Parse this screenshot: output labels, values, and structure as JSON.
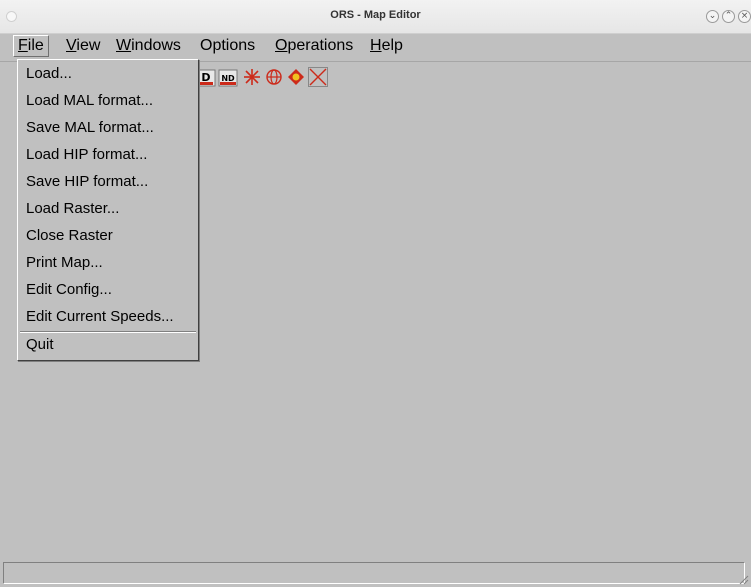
{
  "window": {
    "title": "ORS - Map Editor"
  },
  "menubar": {
    "items": [
      {
        "label": "File",
        "active": true
      },
      {
        "label": "View"
      },
      {
        "label": "Windows"
      },
      {
        "label": "Options"
      },
      {
        "label": "Operations"
      },
      {
        "label": "Help"
      }
    ]
  },
  "file_menu": {
    "items": [
      "Load...",
      "Load MAL format...",
      "Save MAL format...",
      "Load HIP format...",
      "Save HIP format...",
      "Load Raster...",
      "Close Raster",
      "Print Map...",
      "Edit Config...",
      "Edit Current Speeds...",
      "Quit"
    ]
  },
  "toolbar": {
    "icons": [
      "d-tool-icon",
      "nd-tool-icon",
      "star-tool-icon",
      "globe-tool-icon",
      "diamond-tool-icon",
      "cross-tool-icon"
    ],
    "d_label": "D",
    "nd_label": "ND"
  },
  "colors": {
    "background": "#c0c0c0",
    "icon_red": "#cc2a1a"
  }
}
